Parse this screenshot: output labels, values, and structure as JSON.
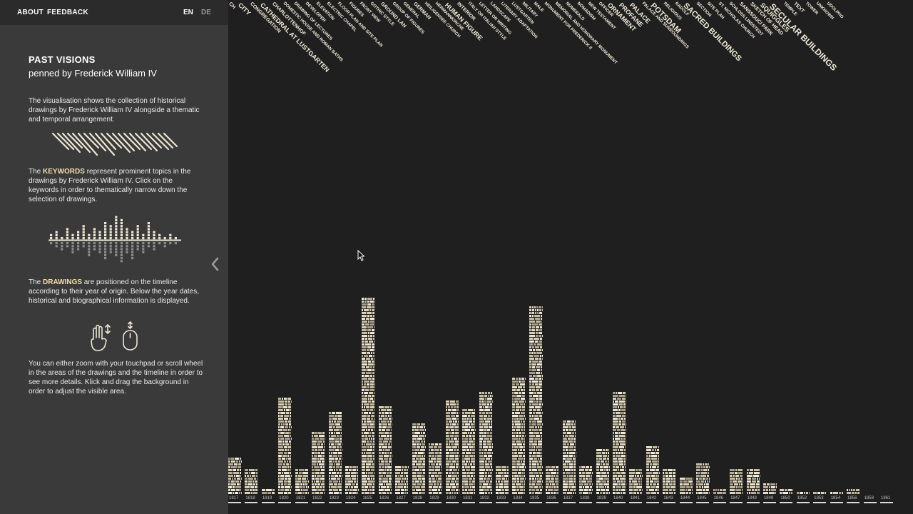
{
  "nav": {
    "about": "ABOUT",
    "feedback": "FEEDBACK",
    "lang_en": "EN",
    "lang_de": "DE"
  },
  "intro": {
    "title": "PAST VISIONS",
    "subtitle": "penned by Frederick William IV",
    "para1": "The visualisation shows the collection of historical drawings by Frederick William IV alongside a thematic and temporal arrangement.",
    "para2_prefix": "The ",
    "para2_keyword": "KEYWORDS",
    "para2_suffix": " represent prominent topics in the drawings by Frederick William IV. Click on the keywords in order to thematically narrow down the selection of drawings.",
    "para3_prefix": "The ",
    "para3_keyword": "DRAWINGS",
    "para3_suffix": " are positioned on the timeline according to their year of origin. Below the year dates, historical and biographical information is displayed.",
    "para4": "You can either zoom with your touchpad or scroll wheel in the areas of the drawings and the timeline in order to see more details. Klick and drag the background in order to adjust the visible area."
  },
  "colors": {
    "sidebar_bg": "#3a3a3a",
    "topbar_bg": "#2b2b2b",
    "viz_bg": "#1f1f1f",
    "highlight": "#f4dfa4",
    "keyword_text": "#f1ead6"
  },
  "keywords": [
    {
      "label": "CH",
      "size": 7
    },
    {
      "label": "CITY",
      "size": 9
    },
    {
      "label": "CONGREGATION",
      "size": 7
    },
    {
      "label": "CATHEDRAL AT LUSTGARTEN",
      "size": 9
    },
    {
      "label": "CHARLOTTENHOF",
      "size": 7
    },
    {
      "label": "DOMESTIC HOUSE AND ROMAN BATHS",
      "size": 6
    },
    {
      "label": "DRAWING OF LECTURES",
      "size": 6
    },
    {
      "label": "DEVELOPER",
      "size": 6
    },
    {
      "label": "ELEVATION",
      "size": 6
    },
    {
      "label": "ELECTRIC CHAPEL",
      "size": 6
    },
    {
      "label": "FLOOR PLAN AND SITE PLAN",
      "size": 6
    },
    {
      "label": "FIGURES",
      "size": 6
    },
    {
      "label": "FRONT VIEW",
      "size": 6
    },
    {
      "label": "GOTHIC STYLE",
      "size": 6
    },
    {
      "label": "GROUND LAN",
      "size": 7
    },
    {
      "label": "GROUP OF FIGURES",
      "size": 6
    },
    {
      "label": "GENERAL",
      "size": 6
    },
    {
      "label": "GERMAN",
      "size": 7
    },
    {
      "label": "HEILIGENSEE CHURCH",
      "size": 6
    },
    {
      "label": "HERMANNKIRCHE",
      "size": 6
    },
    {
      "label": "HUMAN FIGURE",
      "size": 9
    },
    {
      "label": "INTERIOR",
      "size": 7
    },
    {
      "label": "ITALY OR ITALIAN STYLE",
      "size": 6
    },
    {
      "label": "LETTER OR WRITING",
      "size": 6
    },
    {
      "label": "LANDSCAPE",
      "size": 6
    },
    {
      "label": "LITERARY ADAPTATION",
      "size": 6
    },
    {
      "label": "LUSTGARTEN",
      "size": 6
    },
    {
      "label": "MILITARY",
      "size": 6
    },
    {
      "label": "MALE",
      "size": 6
    },
    {
      "label": "MONUMENT FOR FREDERICK II",
      "size": 6
    },
    {
      "label": "MEMORIAL AND HONORARY MONUMENT",
      "size": 6
    },
    {
      "label": "NUMERALS",
      "size": 6
    },
    {
      "label": "NOMADISM",
      "size": 6
    },
    {
      "label": "NEW TESTAMENT",
      "size": 6
    },
    {
      "label": "OFFICER",
      "size": 6
    },
    {
      "label": "ORNAMENT",
      "size": 9
    },
    {
      "label": "PROFANE",
      "size": 9
    },
    {
      "label": "PALACE",
      "size": 9
    },
    {
      "label": "PALACE AND SURROUNDINGS",
      "size": 6
    },
    {
      "label": "POTSDAM",
      "size": 11
    },
    {
      "label": "RELIGIOUS",
      "size": 6
    },
    {
      "label": "RADOLF",
      "size": 6
    },
    {
      "label": "SACRED BUILDINGS",
      "size": 11
    },
    {
      "label": "SECTION",
      "size": 6
    },
    {
      "label": "SITE PLAN",
      "size": 6
    },
    {
      "label": "ST. NICHOLAS CHURCH",
      "size": 6
    },
    {
      "label": "SCHLOSS LINDSTEDT",
      "size": 6
    },
    {
      "label": "SANSSOUCI PARK",
      "size": 7
    },
    {
      "label": "SKETCH OF HEAD",
      "size": 7
    },
    {
      "label": "SQUIGGLES",
      "size": 9
    },
    {
      "label": "SECULAR BUILDINGS",
      "size": 12
    },
    {
      "label": "TEMPLE",
      "size": 6
    },
    {
      "label": "TEXT",
      "size": 7
    },
    {
      "label": "TOWER",
      "size": 6
    },
    {
      "label": "UNKNOWN",
      "size": 6
    },
    {
      "label": "UDOLPHO",
      "size": 6
    }
  ],
  "timeline": {
    "years": [
      "1817",
      "1818",
      "1819",
      "1820",
      "1821",
      "1822",
      "1823",
      "1824",
      "1825",
      "1826",
      "1827",
      "1828",
      "1829",
      "1830",
      "1831",
      "1832",
      "1833",
      "1834",
      "1835",
      "1836",
      "1837",
      "1838",
      "1839",
      "1840",
      "1841",
      "1842",
      "1843",
      "1844",
      "1845",
      "1846",
      "1847",
      "1848",
      "1849",
      "1850",
      "1852",
      "1853",
      "1854",
      "1856",
      "1858",
      "1861"
    ],
    "counts": [
      13,
      9,
      2,
      34,
      9,
      22,
      29,
      10,
      69,
      31,
      10,
      25,
      18,
      33,
      30,
      36,
      10,
      41,
      66,
      10,
      26,
      10,
      16,
      36,
      9,
      17,
      9,
      6,
      11,
      2,
      9,
      9,
      4,
      2,
      1,
      1,
      1,
      2,
      0,
      0
    ]
  }
}
